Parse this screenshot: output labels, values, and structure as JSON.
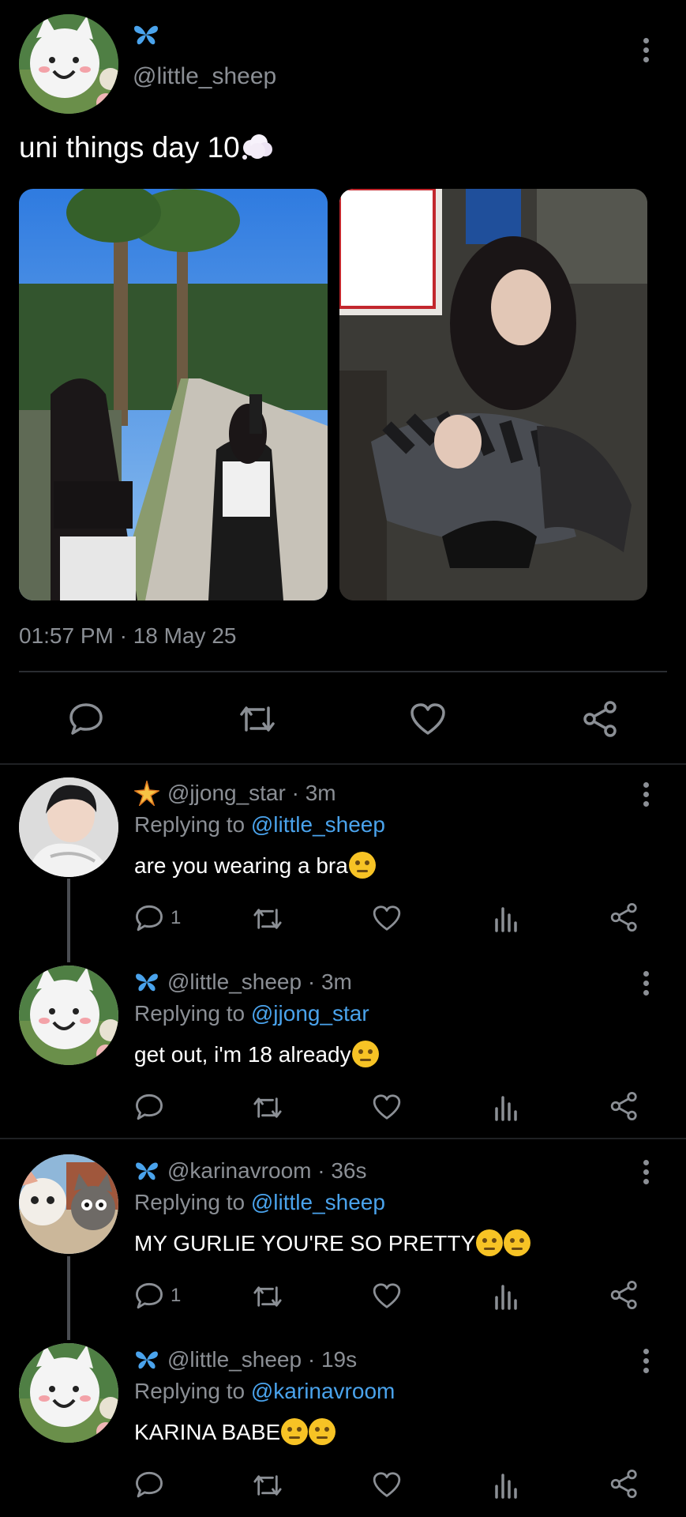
{
  "post": {
    "handle": "@little_sheep",
    "text": "uni things day 10",
    "time": "01:57 PM · 18 May 25"
  },
  "replies": [
    {
      "handle": "@jjong_star · 3m",
      "replying_label": "Replying to",
      "replying_to": "@little_sheep",
      "text": "are you wearing a bra",
      "reply_count": "1"
    },
    {
      "handle": "@little_sheep · 3m",
      "replying_label": "Replying to",
      "replying_to": "@jjong_star",
      "text": "get out, i'm 18 already",
      "reply_count": ""
    },
    {
      "handle": "@karinavroom · 36s",
      "replying_label": "Replying to",
      "replying_to": "@little_sheep",
      "text": "MY GURLIE YOU'RE SO PRETTY",
      "reply_count": "1"
    },
    {
      "handle": "@little_sheep · 19s",
      "replying_label": "Replying to",
      "replying_to": "@karinavroom",
      "text": "KARINA BABE",
      "reply_count": ""
    }
  ],
  "colors": {
    "background": "#000000",
    "muted": "#8b8f95",
    "link": "#4aa3ec",
    "butterfly": "#4aa3ec",
    "star": "#f6c445"
  }
}
